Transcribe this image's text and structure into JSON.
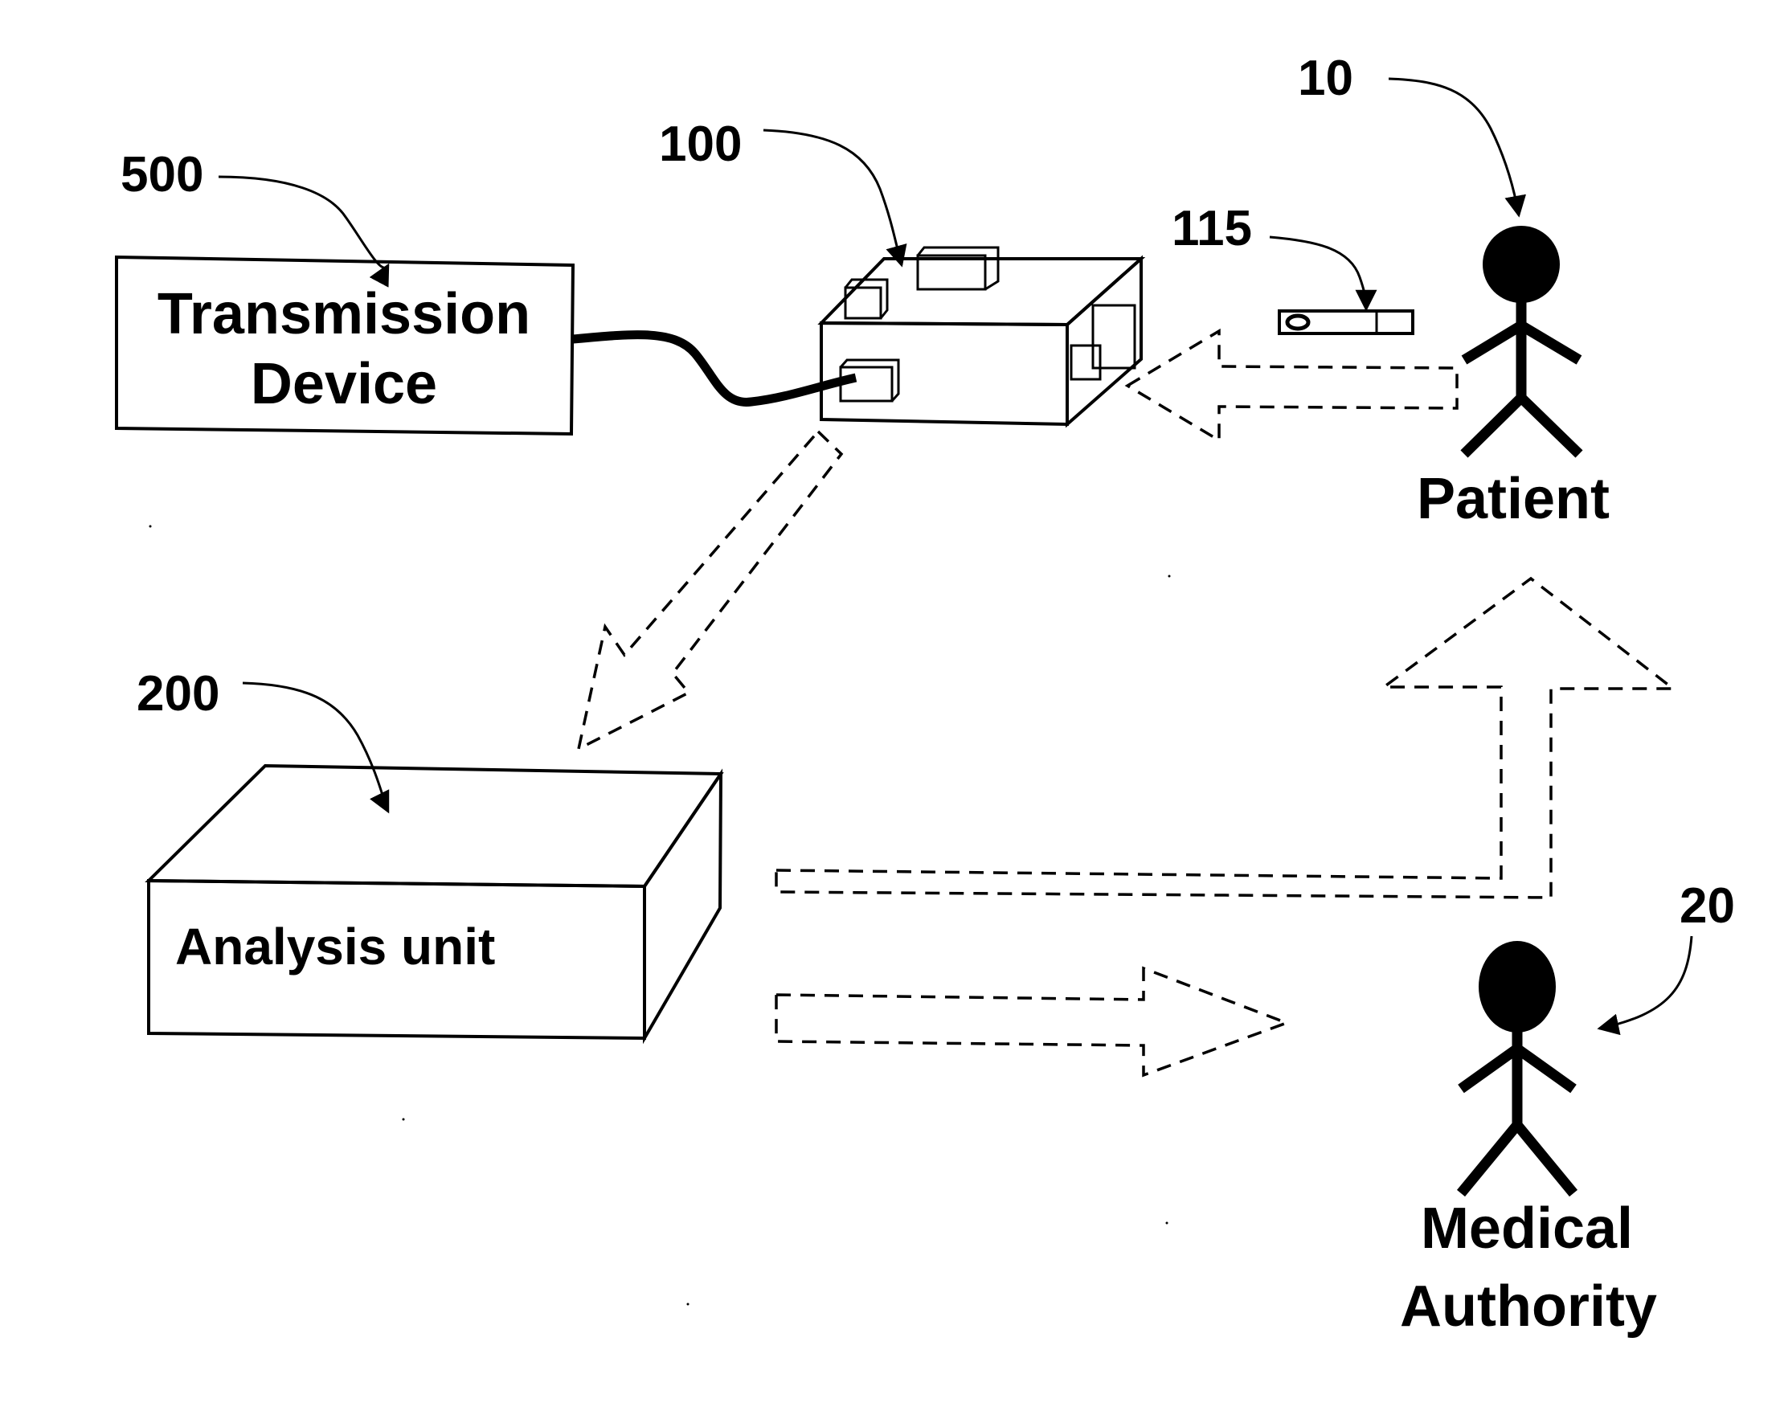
{
  "diagram": {
    "components": {
      "transmission_device": {
        "ref": "500",
        "label_line1": "Transmission",
        "label_line2": "Device"
      },
      "device": {
        "ref": "100"
      },
      "test_strip": {
        "ref": "115"
      },
      "analysis_unit": {
        "ref": "200",
        "label": "Analysis unit"
      },
      "patient": {
        "ref": "10",
        "label": "Patient"
      },
      "medical_authority": {
        "ref": "20",
        "label_line1": "Medical",
        "label_line2": "Authority"
      }
    },
    "flows": [
      {
        "from": "patient",
        "to": "device",
        "style": "dashed-arrow"
      },
      {
        "from": "device",
        "to": "analysis_unit",
        "style": "dashed-arrow"
      },
      {
        "from": "analysis_unit",
        "to": "patient",
        "style": "dashed-arrow"
      },
      {
        "from": "analysis_unit",
        "to": "medical_authority",
        "style": "dashed-arrow"
      }
    ],
    "connections": [
      {
        "from": "transmission_device",
        "to": "device",
        "style": "cable"
      }
    ]
  }
}
